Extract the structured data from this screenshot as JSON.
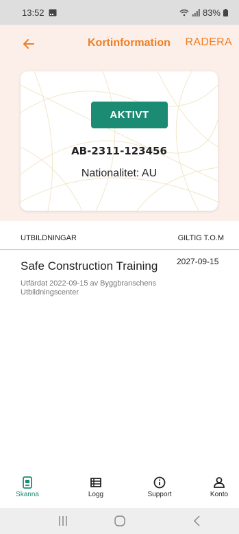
{
  "status_bar": {
    "time": "13:52",
    "battery": "83%",
    "icons": [
      "image-icon",
      "wifi-icon",
      "signal-icon",
      "battery-icon"
    ]
  },
  "app_bar": {
    "title": "Kortinformation",
    "delete_label": "RADERA",
    "back_icon": "back-arrow-icon"
  },
  "card": {
    "status": "AKTIVT",
    "number": "AB-2311-123456",
    "nationality": "Nationalitet: AU"
  },
  "table": {
    "headers": {
      "left": "UTBILDNINGAR",
      "right": "GILTIG T.O.M"
    },
    "rows": [
      {
        "title": "Safe Construction Training",
        "valid_until": "2027-09-15",
        "issued": "Utfärdat 2022-09-15 av Byggbranschens Utbildningscenter"
      }
    ]
  },
  "bottom_nav": {
    "items": [
      {
        "label": "Skanna",
        "icon": "scan-icon",
        "active": true
      },
      {
        "label": "Logg",
        "icon": "log-icon",
        "active": false
      },
      {
        "label": "Support",
        "icon": "info-icon",
        "active": false
      },
      {
        "label": "Konto",
        "icon": "account-icon",
        "active": false
      }
    ]
  },
  "colors": {
    "accent": "#ef7d22",
    "active_green": "#1c8b73",
    "header_bg": "#fcefe9"
  }
}
